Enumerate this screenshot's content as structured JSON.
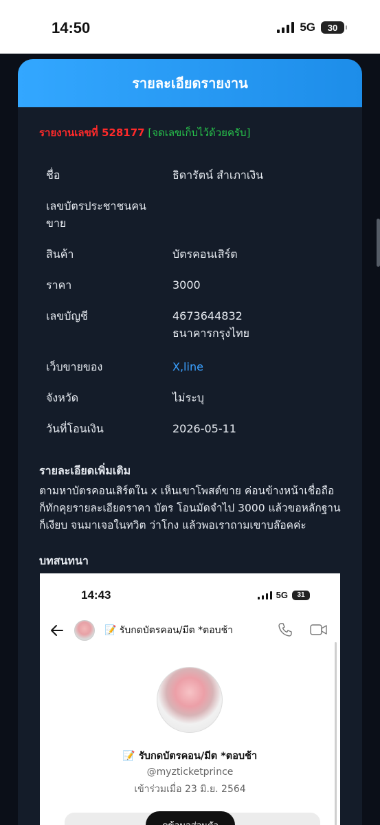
{
  "status_bar": {
    "time": "14:50",
    "network": "5G",
    "battery": "30"
  },
  "card": {
    "title": "รายละเอียดรายงาน"
  },
  "report": {
    "label": "รายงานเลขที่ 528177",
    "note": "[จดเลขเก็บไว้ด้วยครับ]"
  },
  "fields": [
    {
      "label": "ชื่อ",
      "value": "ธิดารัตน์ สำเภาเงิน"
    },
    {
      "label": "เลขบัตรประชาชนคนขาย",
      "value": ""
    },
    {
      "label": "สินค้า",
      "value": "บัตรคอนเสิร์ต"
    },
    {
      "label": "ราคา",
      "value": "3000"
    },
    {
      "label": "เลขบัญชี",
      "value": "4673644832 ธนาคารกรุงไทย"
    },
    {
      "label": "เว็บขายของ",
      "value": "X,line"
    },
    {
      "label": "จังหวัด",
      "value": "ไม่ระบุ"
    },
    {
      "label": "วันที่โอนเงิน",
      "value": "2026-05-11"
    }
  ],
  "more": {
    "title": "รายละเอียดเพิ่มเติม",
    "text": "ตามหาบัตรคอนเสิร์ตใน x เห็นเขาโพสต์ขาย ค่อนข้างหน้าเชื่อถือ ก็ทักคุยรายละเอียดราคา บัตร โอนมัดจำไป 3000 แล้วขอหลักฐาน ก็เงียบ จนมาเจอในทวิต ว่าโกง แล้วพอเราถามเขาบล๊อคค่ะ",
    "conversation_label": "บทสนทนา"
  },
  "screenshot": {
    "time": "14:43",
    "network": "5G",
    "battery": "31",
    "chat_name": "📝 รับกดบัตรคอน/มีต *ตอบช้า",
    "display_name": "📝 รับกดบัตรคอน/มีต *ตอบช้า",
    "handle": "@myzticketprince",
    "joined": "เข้าร่วมเมื่อ 23 มิ.ย. 2564",
    "button_label": "ดูข้อมูลส่วนตัว"
  }
}
